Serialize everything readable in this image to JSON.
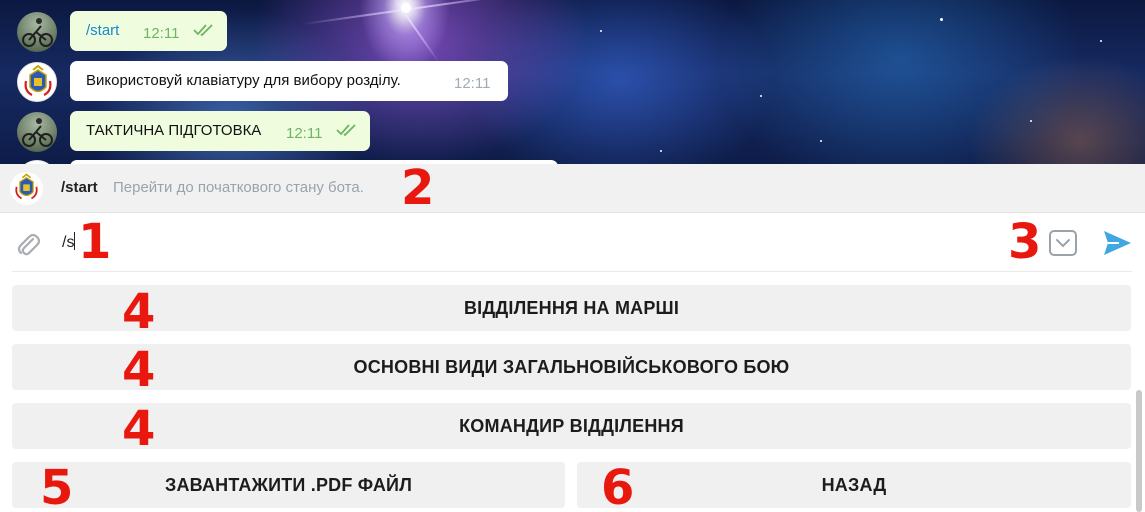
{
  "messages": [
    {
      "type": "outgoing",
      "text": "/start",
      "is_command": true,
      "time": "12:11"
    },
    {
      "type": "incoming",
      "text": "Використовуй клавіатуру для вибору розділу.",
      "time": "12:11"
    },
    {
      "type": "outgoing",
      "text": "ТАКТИЧНА ПІДГОТОВКА",
      "time": "12:11"
    }
  ],
  "suggestion": {
    "command": "/start",
    "description": "Перейти до початкового стану бота."
  },
  "input": {
    "value": "/s"
  },
  "icons": {
    "attach": "paperclip-icon",
    "keyboard_toggle": "keyboard-toggle-icon",
    "send": "send-icon",
    "read_receipt": "double-check-icon"
  },
  "keyboard": {
    "rows": [
      [
        "ВІДДІЛЕННЯ НА МАРШІ"
      ],
      [
        "ОСНОВНІ ВИДИ ЗАГАЛЬНОВІЙСЬКОВОГО БОЮ"
      ],
      [
        "КОМАНДИР ВІДДІЛЕННЯ"
      ],
      [
        "ЗАВАНТАЖИТИ .PDF ФАЙЛ",
        "НАЗАД"
      ]
    ]
  },
  "annotations": [
    "1",
    "2",
    "3",
    "4",
    "4",
    "4",
    "5",
    "6"
  ],
  "colors": {
    "outgoing_bubble": "#effdde",
    "incoming_bubble": "#ffffff",
    "command_link": "#168acd",
    "send_icon": "#40a7e3",
    "annotation": "#e8180f",
    "keyboard_button": "#f0f0f0"
  }
}
